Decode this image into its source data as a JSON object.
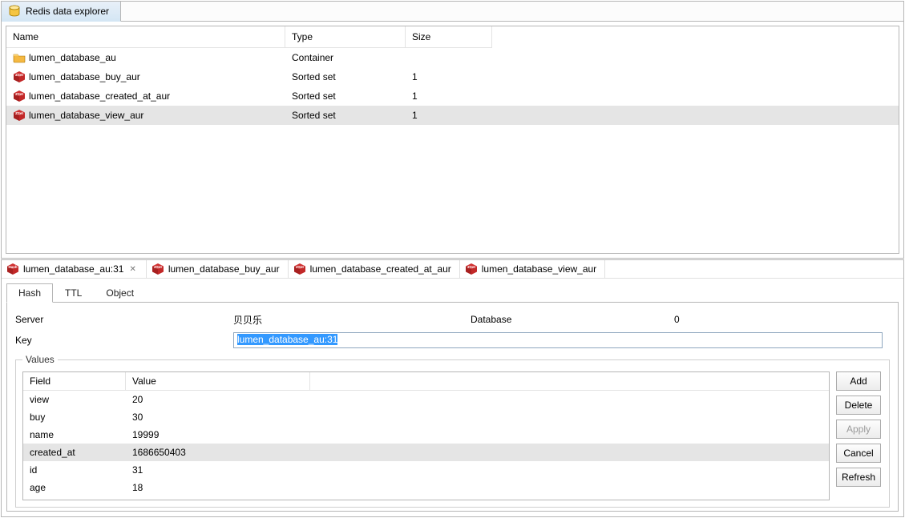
{
  "app": {
    "tab_title": "Redis data explorer"
  },
  "explorer": {
    "columns": {
      "name": "Name",
      "type": "Type",
      "size": "Size"
    },
    "rows": [
      {
        "icon": "folder",
        "name": "lumen_database_au",
        "type": "Container",
        "size": "",
        "selected": false
      },
      {
        "icon": "zset",
        "name": "lumen_database_buy_aur",
        "type": "Sorted set",
        "size": "1",
        "selected": false
      },
      {
        "icon": "zset",
        "name": "lumen_database_created_at_aur",
        "type": "Sorted set",
        "size": "1",
        "selected": false
      },
      {
        "icon": "zset",
        "name": "lumen_database_view_aur",
        "type": "Sorted set",
        "size": "1",
        "selected": true
      }
    ]
  },
  "editors": {
    "tabs": [
      {
        "icon": "hash",
        "label": "lumen_database_au:31",
        "active": true,
        "closable": true
      },
      {
        "icon": "zset",
        "label": "lumen_database_buy_aur",
        "active": false,
        "closable": false
      },
      {
        "icon": "zset",
        "label": "lumen_database_created_at_aur",
        "active": false,
        "closable": false
      },
      {
        "icon": "zset",
        "label": "lumen_database_view_aur",
        "active": false,
        "closable": false
      }
    ]
  },
  "detail": {
    "subtabs": {
      "hash": "Hash",
      "ttl": "TTL",
      "object": "Object"
    },
    "server_label": "Server",
    "server_value": "贝贝乐",
    "database_label": "Database",
    "database_value": "0",
    "key_label": "Key",
    "key_value": "lumen_database_au:31",
    "values_label": "Values",
    "values_columns": {
      "field": "Field",
      "value": "Value"
    },
    "values_rows": [
      {
        "field": "view",
        "value": "20",
        "selected": false
      },
      {
        "field": "buy",
        "value": "30",
        "selected": false
      },
      {
        "field": "name",
        "value": "19999",
        "selected": false
      },
      {
        "field": "created_at",
        "value": "1686650403",
        "selected": true
      },
      {
        "field": "id",
        "value": "31",
        "selected": false
      },
      {
        "field": "age",
        "value": "18",
        "selected": false
      }
    ],
    "buttons": {
      "add": "Add",
      "delete": "Delete",
      "apply": "Apply",
      "cancel": "Cancel",
      "refresh": "Refresh"
    }
  }
}
